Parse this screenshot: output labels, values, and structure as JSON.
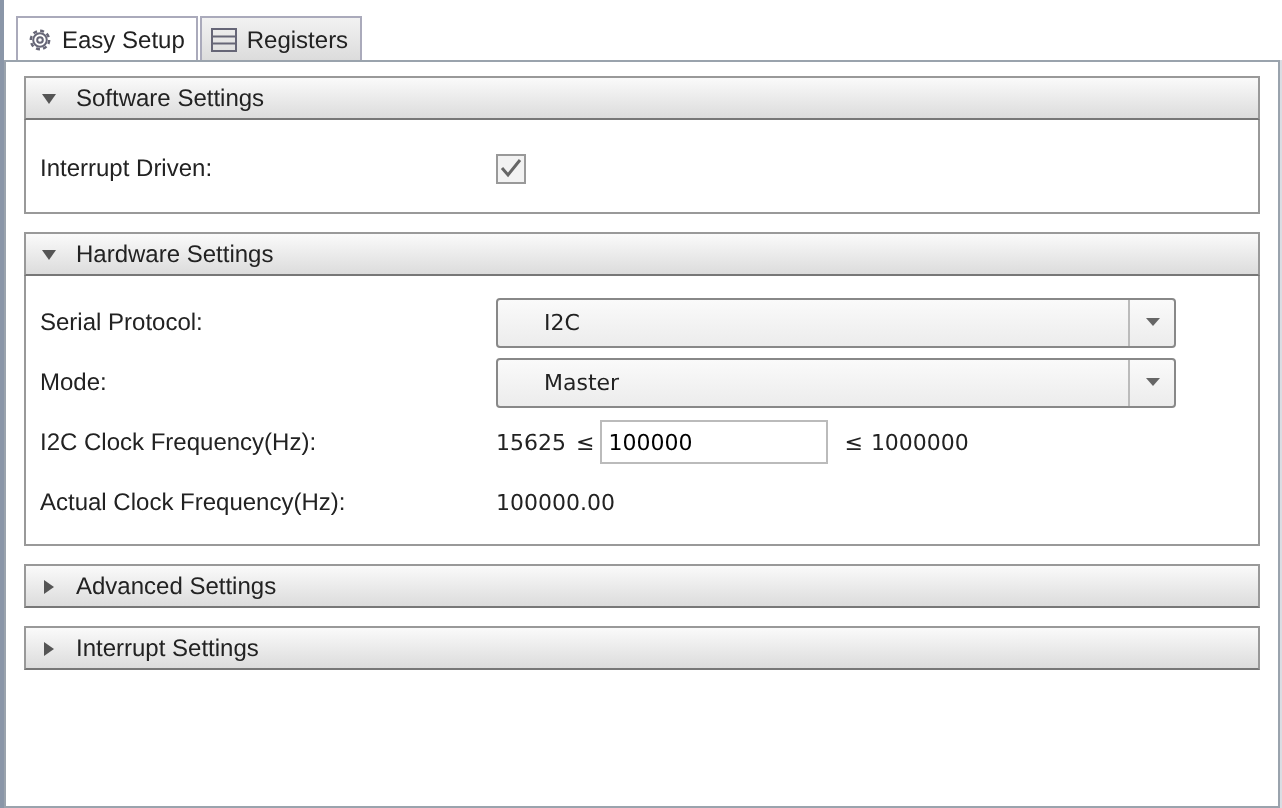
{
  "tabs": [
    {
      "label": "Easy Setup",
      "selected": true
    },
    {
      "label": "Registers",
      "selected": false
    }
  ],
  "sections": [
    {
      "title": "Software Settings",
      "expanded": true,
      "fields": [
        {
          "kind": "checkbox",
          "label": "Interrupt Driven:",
          "checked": true
        }
      ]
    },
    {
      "title": "Hardware Settings",
      "expanded": true,
      "fields": [
        {
          "kind": "combo",
          "label": "Serial Protocol:",
          "value": "I2C"
        },
        {
          "kind": "combo",
          "label": "Mode:",
          "value": "Master"
        },
        {
          "kind": "range",
          "label": "I2C Clock Frequency(Hz):",
          "min": "15625",
          "min_sign": "≤",
          "value": "100000",
          "max_sign": "≤",
          "max": "1000000"
        },
        {
          "kind": "readout",
          "label": "Actual Clock Frequency(Hz):",
          "value": "100000.00"
        }
      ]
    },
    {
      "title": "Advanced Settings",
      "expanded": false
    },
    {
      "title": "Interrupt Settings",
      "expanded": false
    }
  ]
}
